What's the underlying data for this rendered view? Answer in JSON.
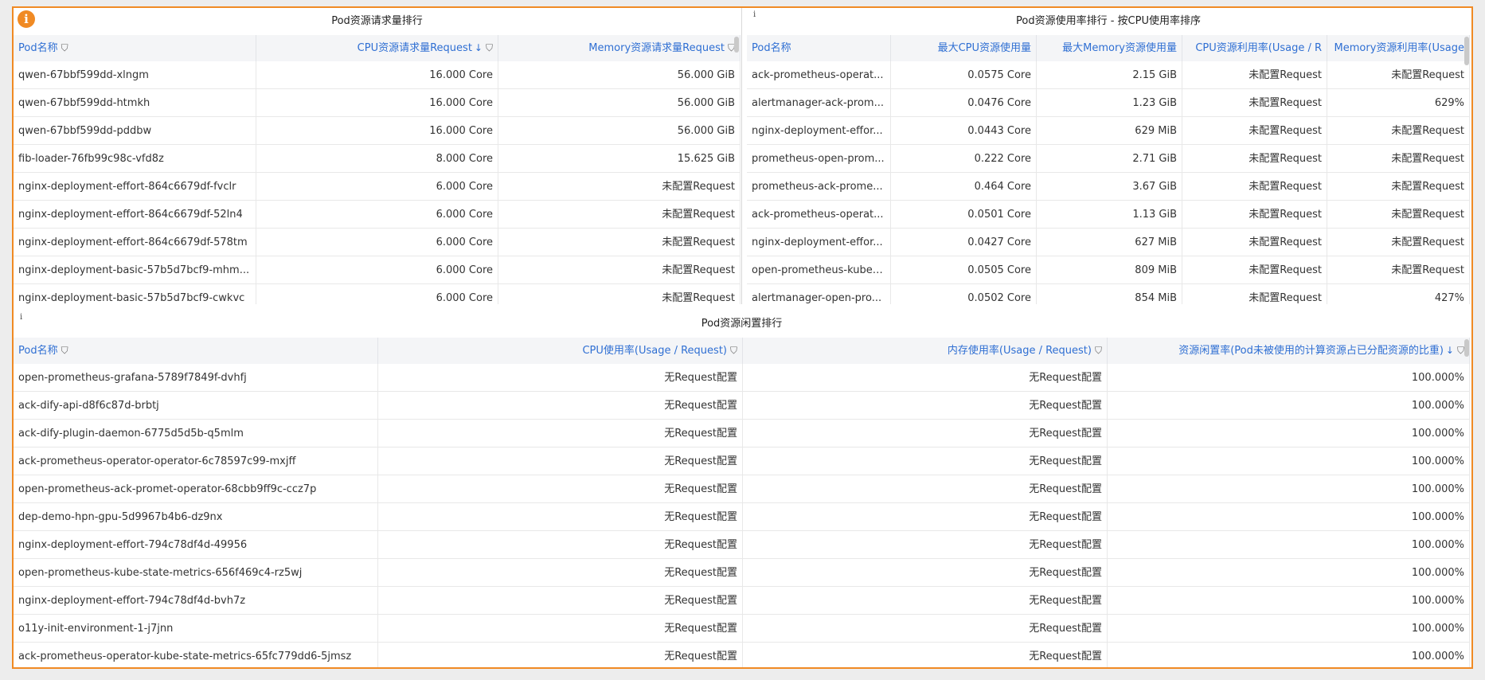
{
  "badge": {
    "label": "i",
    "color": "#f08a24"
  },
  "panel1": {
    "title": "Pod资源请求量排行",
    "columns": [
      "Pod名称",
      "CPU资源请求量Request",
      "Memory资源请求量Request"
    ],
    "rows": [
      [
        "qwen-67bbf599dd-xlngm",
        "16.000 Core",
        "56.000 GiB"
      ],
      [
        "qwen-67bbf599dd-htmkh",
        "16.000 Core",
        "56.000 GiB"
      ],
      [
        "qwen-67bbf599dd-pddbw",
        "16.000 Core",
        "56.000 GiB"
      ],
      [
        "fib-loader-76fb99c98c-vfd8z",
        "8.000 Core",
        "15.625 GiB"
      ],
      [
        "nginx-deployment-effort-864c6679df-fvclr",
        "6.000 Core",
        "未配置Request"
      ],
      [
        "nginx-deployment-effort-864c6679df-52ln4",
        "6.000 Core",
        "未配置Request"
      ],
      [
        "nginx-deployment-effort-864c6679df-578tm",
        "6.000 Core",
        "未配置Request"
      ],
      [
        "nginx-deployment-basic-57b5d7bcf9-mhm...",
        "6.000 Core",
        "未配置Request"
      ],
      [
        "nginx-deployment-basic-57b5d7bcf9-cwkvc",
        "6.000 Core",
        "未配置Request"
      ]
    ]
  },
  "panel2": {
    "title": "Pod资源使用率排行 - 按CPU使用率排序",
    "info": "i",
    "columns": [
      "Pod名称",
      "最大CPU资源使用量",
      "最大Memory资源使用量",
      "CPU资源利用率(Usage / R",
      "Memory资源利用率(Usage"
    ],
    "rows": [
      [
        "ack-prometheus-operat...",
        "0.0575 Core",
        "2.15 GiB",
        "未配置Request",
        "未配置Request"
      ],
      [
        "alertmanager-ack-prom...",
        "0.0476 Core",
        "1.23 GiB",
        "未配置Request",
        "629%"
      ],
      [
        "nginx-deployment-effor...",
        "0.0443 Core",
        "629 MiB",
        "未配置Request",
        "未配置Request"
      ],
      [
        "prometheus-open-prom...",
        "0.222 Core",
        "2.71 GiB",
        "未配置Request",
        "未配置Request"
      ],
      [
        "prometheus-ack-prome...",
        "0.464 Core",
        "3.67 GiB",
        "未配置Request",
        "未配置Request"
      ],
      [
        "ack-prometheus-operat...",
        "0.0501 Core",
        "1.13 GiB",
        "未配置Request",
        "未配置Request"
      ],
      [
        "nginx-deployment-effor...",
        "0.0427 Core",
        "627 MiB",
        "未配置Request",
        "未配置Request"
      ],
      [
        "open-prometheus-kube-...",
        "0.0505 Core",
        "809 MiB",
        "未配置Request",
        "未配置Request"
      ],
      [
        "alertmanager-open-pro...",
        "0.0502 Core",
        "854 MiB",
        "未配置Request",
        "427%"
      ]
    ]
  },
  "panel3": {
    "title": "Pod资源闲置排行",
    "info": "i",
    "columns": [
      "Pod名称",
      "CPU使用率(Usage / Request)",
      "内存使用率(Usage / Request)",
      "资源闲置率(Pod未被使用的计算资源占已分配资源的比重)"
    ],
    "rows": [
      [
        "open-prometheus-grafana-5789f7849f-dvhfj",
        "无Request配置",
        "无Request配置",
        "100.000%"
      ],
      [
        "ack-dify-api-d8f6c87d-brbtj",
        "无Request配置",
        "无Request配置",
        "100.000%"
      ],
      [
        "ack-dify-plugin-daemon-6775d5d5b-q5mlm",
        "无Request配置",
        "无Request配置",
        "100.000%"
      ],
      [
        "ack-prometheus-operator-operator-6c78597c99-mxjff",
        "无Request配置",
        "无Request配置",
        "100.000%"
      ],
      [
        "open-prometheus-ack-promet-operator-68cbb9ff9c-ccz7p",
        "无Request配置",
        "无Request配置",
        "100.000%"
      ],
      [
        "dep-demo-hpn-gpu-5d9967b4b6-dz9nx",
        "无Request配置",
        "无Request配置",
        "100.000%"
      ],
      [
        "nginx-deployment-effort-794c78df4d-49956",
        "无Request配置",
        "无Request配置",
        "100.000%"
      ],
      [
        "open-prometheus-kube-state-metrics-656f469c4-rz5wj",
        "无Request配置",
        "无Request配置",
        "100.000%"
      ],
      [
        "nginx-deployment-effort-794c78df4d-bvh7z",
        "无Request配置",
        "无Request配置",
        "100.000%"
      ],
      [
        "o11y-init-environment-1-j7jnn",
        "无Request配置",
        "无Request配置",
        "100.000%"
      ],
      [
        "ack-prometheus-operator-kube-state-metrics-65fc779dd6-5jmsz",
        "无Request配置",
        "无Request配置",
        "100.000%"
      ]
    ]
  }
}
